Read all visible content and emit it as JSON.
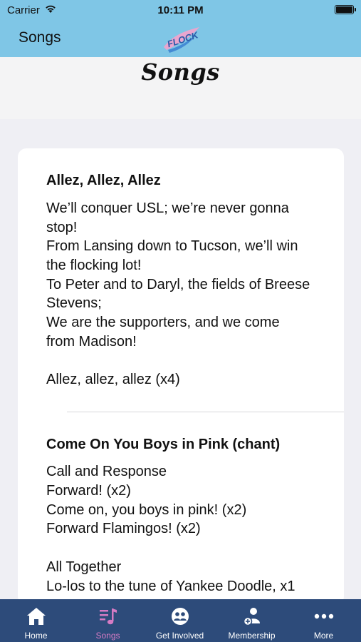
{
  "status_bar": {
    "carrier": "Carrier",
    "time": "10:11 PM"
  },
  "nav": {
    "title": "Songs",
    "logo_text": "FLOCK"
  },
  "page": {
    "title": "Songs"
  },
  "songs": [
    {
      "title": "Allez, Allez, Allez",
      "lines": [
        "We’ll conquer USL; we’re never gonna",
        "stop!",
        "From Lansing down to Tucson, we’ll win",
        "the flocking lot!",
        "To Peter and to Daryl, the fields of Breese",
        "Stevens;",
        "We are the supporters, and we come",
        "from Madison!",
        "",
        "Allez, allez, allez (x4)"
      ]
    },
    {
      "title": "Come On You Boys in Pink (chant)",
      "lines": [
        "Call and Response",
        "Forward! (x2)",
        "Come on, you boys in pink! (x2)",
        "Forward Flamingos! (x2)",
        "",
        "All Together",
        "Lo-los to the tune of Yankee Doodle, x1"
      ]
    }
  ],
  "tabs": [
    {
      "label": "Home",
      "icon": "home-icon",
      "active": false
    },
    {
      "label": "Songs",
      "icon": "music-note-icon",
      "active": true
    },
    {
      "label": "Get Involved",
      "icon": "people-icon",
      "active": false
    },
    {
      "label": "Membership",
      "icon": "add-person-icon",
      "active": false
    },
    {
      "label": "More",
      "icon": "more-dots-icon",
      "active": false
    }
  ],
  "colors": {
    "nav_bar": "#7fc6e6",
    "tab_bar": "#2d4b7a",
    "active_tab": "#d57bc4",
    "logo_pink": "#e9a6cf",
    "logo_blue": "#3a7fd0"
  }
}
